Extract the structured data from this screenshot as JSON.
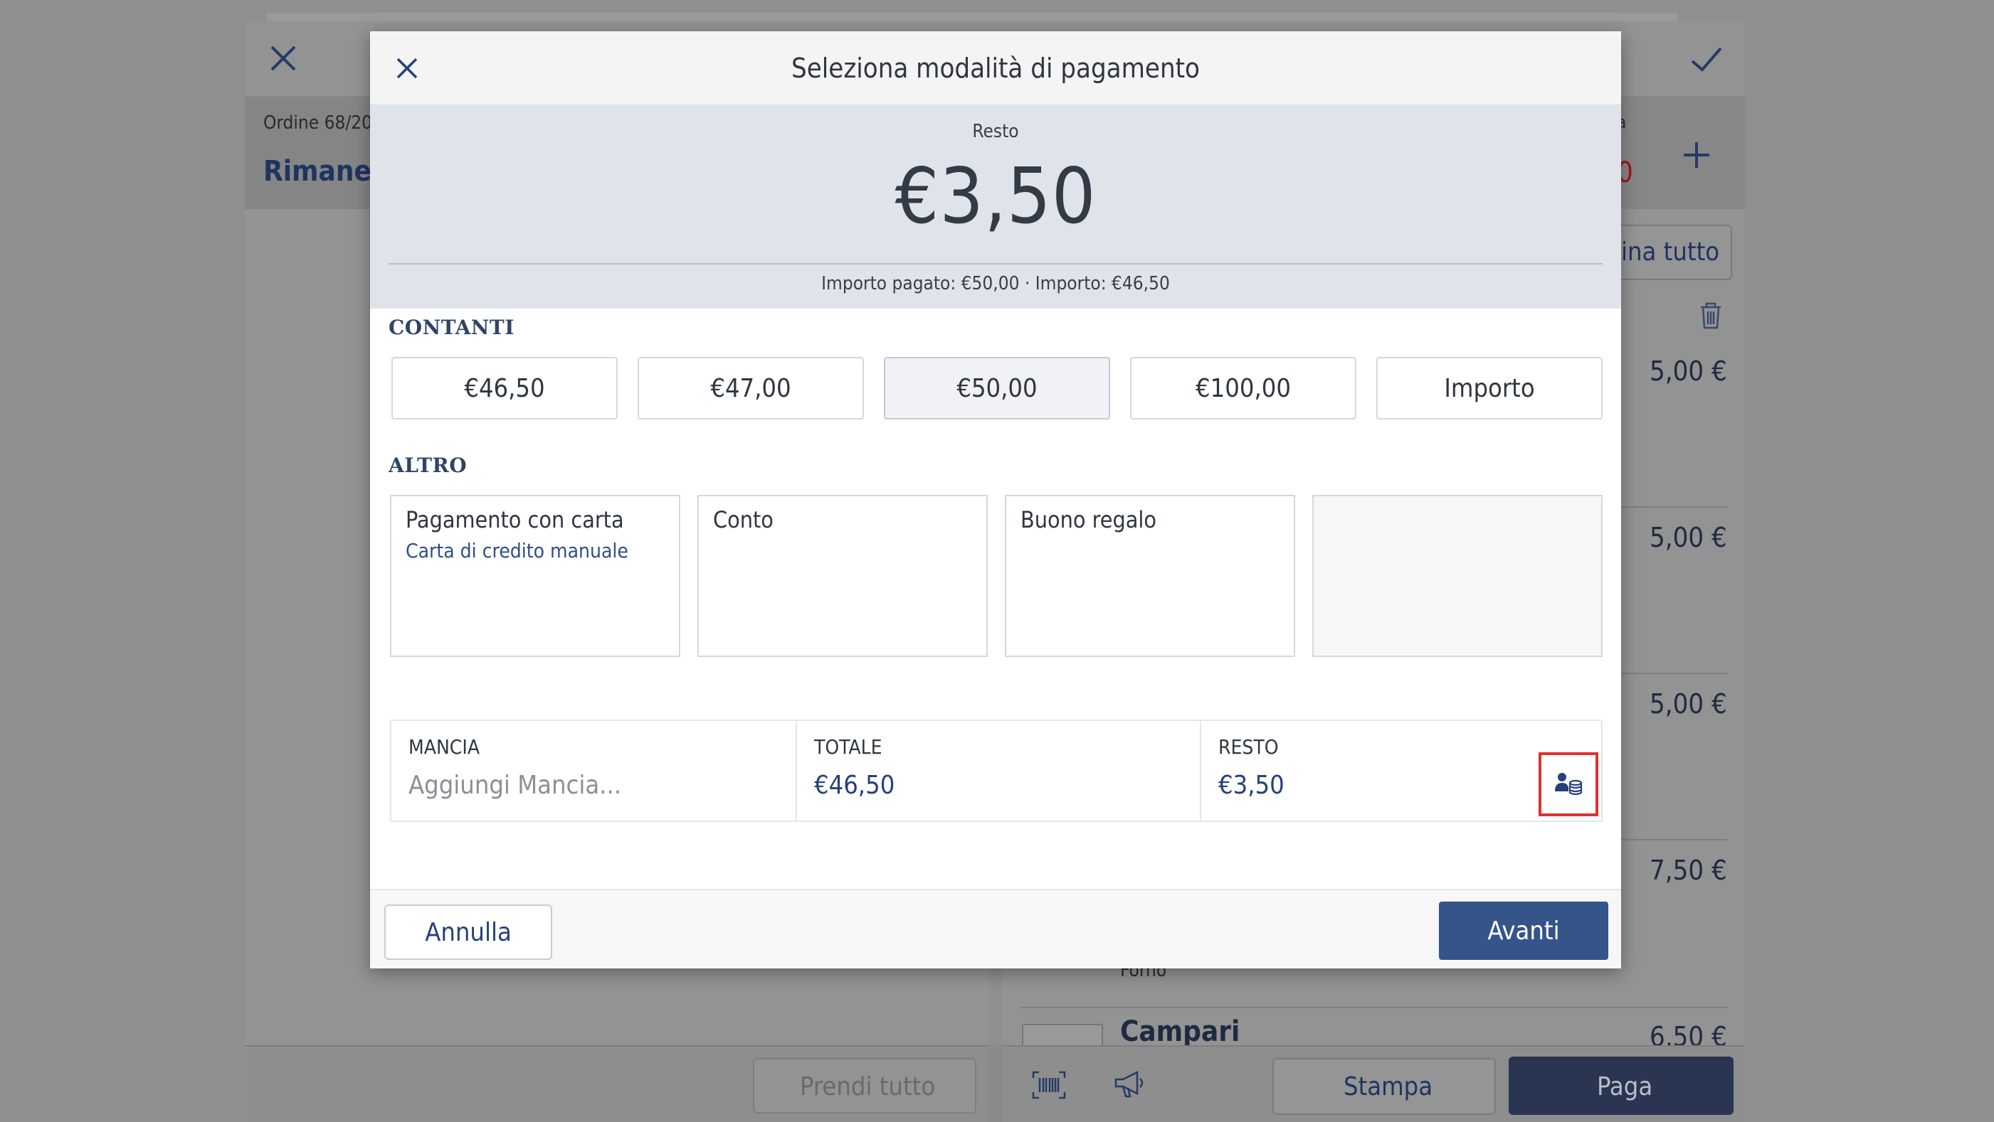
{
  "background": {
    "order_number": "Ordine 68/20",
    "order_title": "Rimanen",
    "right_small_label": "a",
    "right_red_value": "0",
    "take_all_partial": "ina tutto",
    "prices": [
      "5,00 €",
      "5,00 €",
      "5,00 €",
      "7,50 €",
      "6,50 €"
    ],
    "modifier_text": "Forno",
    "item_name": "Campari",
    "take_all_button": "Prendi tutto",
    "print_button": "Stampa",
    "pay_button": "Paga",
    "icons": [
      "close-icon",
      "check-icon",
      "plus-icon",
      "trash-icon",
      "barcode-icon",
      "megaphone-icon"
    ]
  },
  "modal": {
    "title": "Seleziona modalità di pagamento",
    "summary": {
      "label": "Resto",
      "amount": "€3,50",
      "subtext": "Importo pagato: €50,00 · Importo: €46,50"
    },
    "cash": {
      "label": "CONTANTI",
      "options": [
        "€46,50",
        "€47,00",
        "€50,00",
        "€100,00",
        "Importo"
      ],
      "selected": "€50,00"
    },
    "other": {
      "label": "ALTRO",
      "options": [
        {
          "title": "Pagamento con carta",
          "subtitle": "Carta di credito manuale"
        },
        {
          "title": "Conto",
          "subtitle": ""
        },
        {
          "title": "Buono regalo",
          "subtitle": ""
        }
      ]
    },
    "totals": {
      "tip_label": "MANCIA",
      "tip_placeholder": "Aggiungi Mancia...",
      "total_label": "TOTALE",
      "total_value": "€46,50",
      "change_label": "RESTO",
      "change_value": "€3,50"
    },
    "footer": {
      "cancel": "Annulla",
      "next": "Avanti"
    }
  },
  "colors": {
    "primary": "#34548a",
    "summary_bg": "#dfe4eb",
    "highlight": "#e03030"
  }
}
